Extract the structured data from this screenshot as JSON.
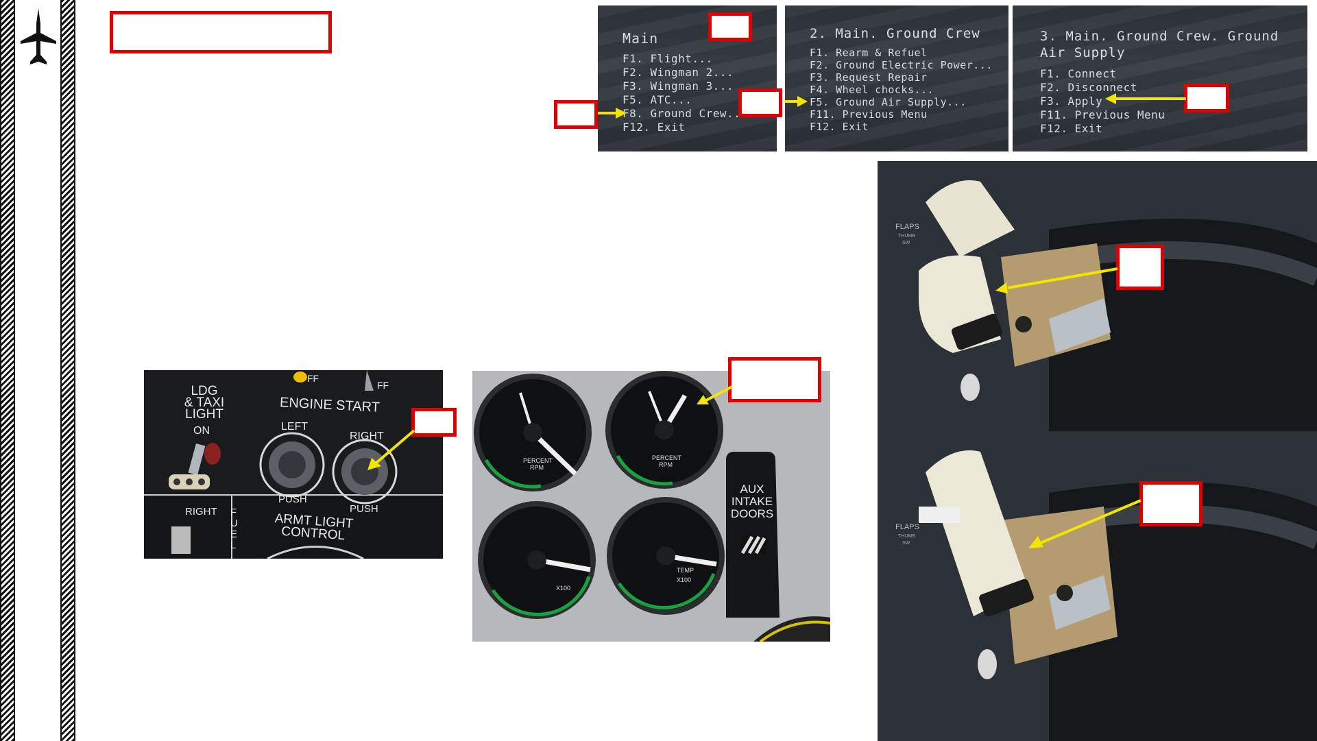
{
  "menu1": {
    "title": "Main",
    "items": [
      "F1. Flight...",
      "F2. Wingman 2...",
      "F3. Wingman 3...",
      "F5. ATC...",
      "F8. Ground Crew...",
      "F12. Exit"
    ]
  },
  "menu2": {
    "title": "2. Main. Ground Crew",
    "items": [
      "F1. Rearm & Refuel",
      "F2. Ground Electric Power...",
      "F3. Request Repair",
      "F4. Wheel chocks...",
      "F5. Ground Air Supply...",
      "F11. Previous Menu",
      "F12. Exit"
    ]
  },
  "menu3": {
    "title_line1": "3. Main. Ground Crew. Ground",
    "title_line2": "Air Supply",
    "items": [
      "F1. Connect",
      "F2. Disconnect",
      "F3. Apply",
      "F11. Previous Menu",
      "F12. Exit"
    ]
  },
  "engine_panel": {
    "ldg_line1": "LDG",
    "ldg_line2": "& TAXI",
    "ldg_line3": "LIGHT",
    "on": "ON",
    "engine_start": "ENGINE START",
    "left": "LEFT",
    "right": "RIGHT",
    "push_left": "PUSH",
    "push_right": "PUSH",
    "right_lower": "RIGHT",
    "fuel": "FUEL",
    "armt_line1": "ARMT LIGHT",
    "armt_line2": "CONTROL",
    "off1": "FF",
    "off2": "FF"
  },
  "gauges": {
    "percent_rpm": "PERCENT RPM",
    "temp": "TEMP",
    "x100": "X100",
    "aux_line1": "AUX",
    "aux_line2": "INTAKE",
    "aux_line3": "DOORS"
  },
  "throttle": {
    "flaps": "FLAPS",
    "thumb": "THUMB",
    "sw": "SW"
  },
  "colors": {
    "callout": "#e00000",
    "arrow": "#f2e600"
  }
}
